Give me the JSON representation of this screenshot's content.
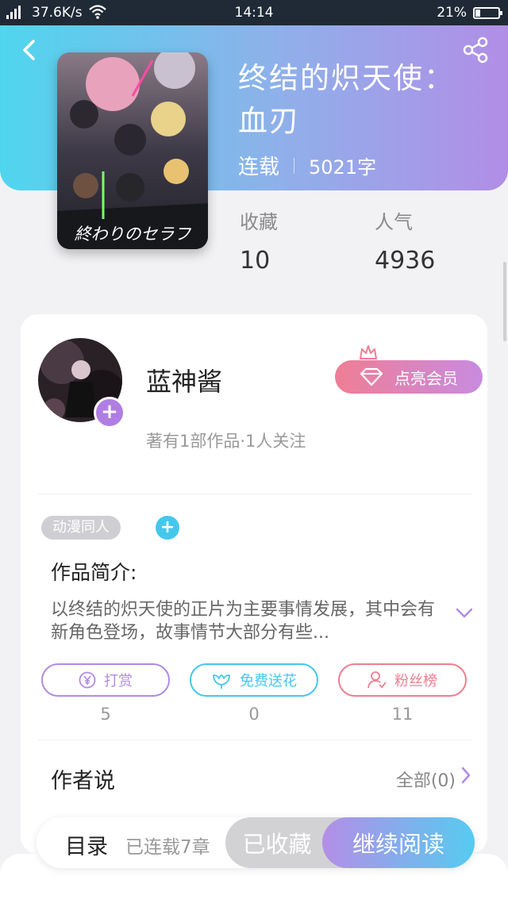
{
  "status_bar": {
    "network_type": "2G",
    "speed": "37.6K/s",
    "time": "14:14",
    "battery": "21%"
  },
  "book": {
    "title": "终结的炽天使：血刃",
    "serial_status": "连载",
    "word_count": "5021字",
    "cover_text": "終わりのセラフ",
    "stats": [
      {
        "label": "收藏",
        "value": "10"
      },
      {
        "label": "人气",
        "value": "4936"
      }
    ]
  },
  "author": {
    "name": "蓝神酱",
    "meta": "著有1部作品·1人关注",
    "follow_icon": "plus-icon",
    "vip_label": "点亮会员"
  },
  "tags": [
    "动漫同人"
  ],
  "intro": {
    "title": "作品简介:",
    "text": "以终结的炽天使的正片为主要事情发展，其中会有新角色登场，故事情节大部分有些..."
  },
  "actions": [
    {
      "label": "打赏",
      "count": "5",
      "icon": "yen-icon",
      "color": "#b18be2"
    },
    {
      "label": "免费送花",
      "count": "0",
      "icon": "flower-icon",
      "color": "#45c7ec"
    },
    {
      "label": "粉丝榜",
      "count": "11",
      "icon": "user-icon",
      "color": "#ef7e8f"
    }
  ],
  "author_says": {
    "label": "作者说",
    "all": "全部(0)"
  },
  "bottom_bar": {
    "toc_label": "目录",
    "chapters": "已连载7章",
    "fav_label": "已收藏",
    "read_label": "继续阅读"
  },
  "colors": {
    "header_start": "#4fd6ee",
    "header_end": "#b18ee6",
    "accent_purple": "#b07ee2",
    "accent_blue": "#45c7ec",
    "accent_pink": "#ef7e95"
  }
}
